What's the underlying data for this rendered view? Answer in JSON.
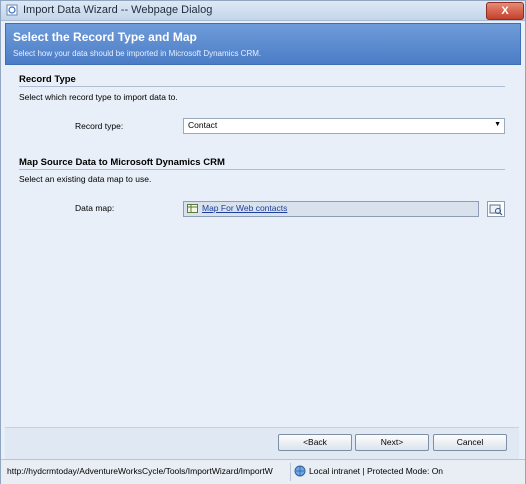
{
  "window": {
    "title": "Import Data Wizard -- Webpage Dialog",
    "close_label": "X"
  },
  "header": {
    "title": "Select the Record Type and Map",
    "subtitle": "Select how your data should be imported in Microsoft Dynamics CRM."
  },
  "record_type": {
    "section_title": "Record Type",
    "description": "Select which record type to import data to.",
    "label": "Record type:",
    "value": "Contact"
  },
  "map": {
    "section_title": "Map Source Data to Microsoft Dynamics CRM",
    "description": "Select an existing data map to use.",
    "label": "Data map:",
    "value": "Map For Web contacts"
  },
  "footer": {
    "back_label": "<Back",
    "next_label": "Next>",
    "cancel_label": "Cancel"
  },
  "status": {
    "url": "http://hydcrmtoday/AdventureWorksCycle/Tools/ImportWizard/ImportW",
    "zone": "Local intranet | Protected Mode: On"
  },
  "icons": {
    "window": "ie-page-icon",
    "map": "data-map-icon",
    "lookup": "lookup-icon",
    "zone": "globe-icon"
  }
}
